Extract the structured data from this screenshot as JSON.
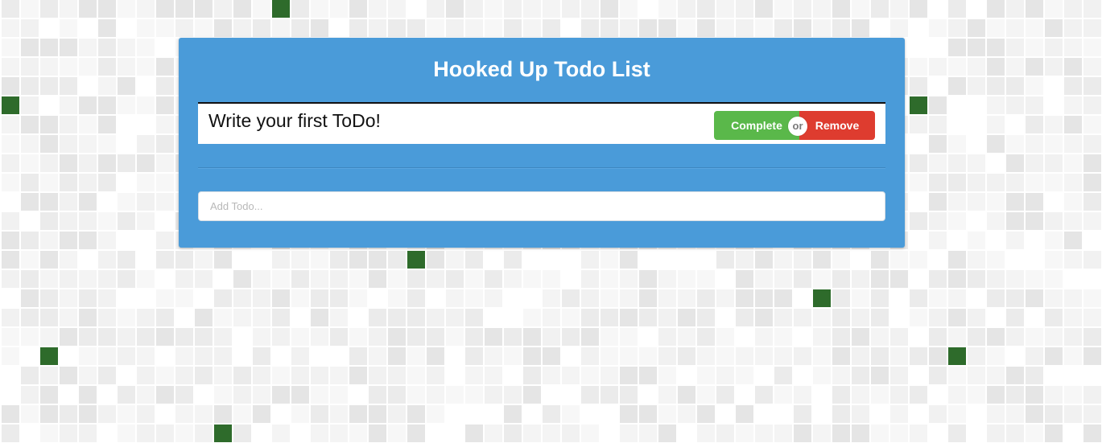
{
  "app": {
    "title": "Hooked Up Todo List"
  },
  "todos": [
    {
      "text": "Write your first ToDo!",
      "complete_label": "Complete",
      "separator_label": "or",
      "remove_label": "Remove"
    }
  ],
  "add_todo": {
    "placeholder": "Add Todo...",
    "value": ""
  },
  "colors": {
    "panel": "#4a9bd9",
    "complete_button": "#5ab84a",
    "remove_button": "#de3c2f",
    "background_tile_accent": "#2e6b2b"
  }
}
